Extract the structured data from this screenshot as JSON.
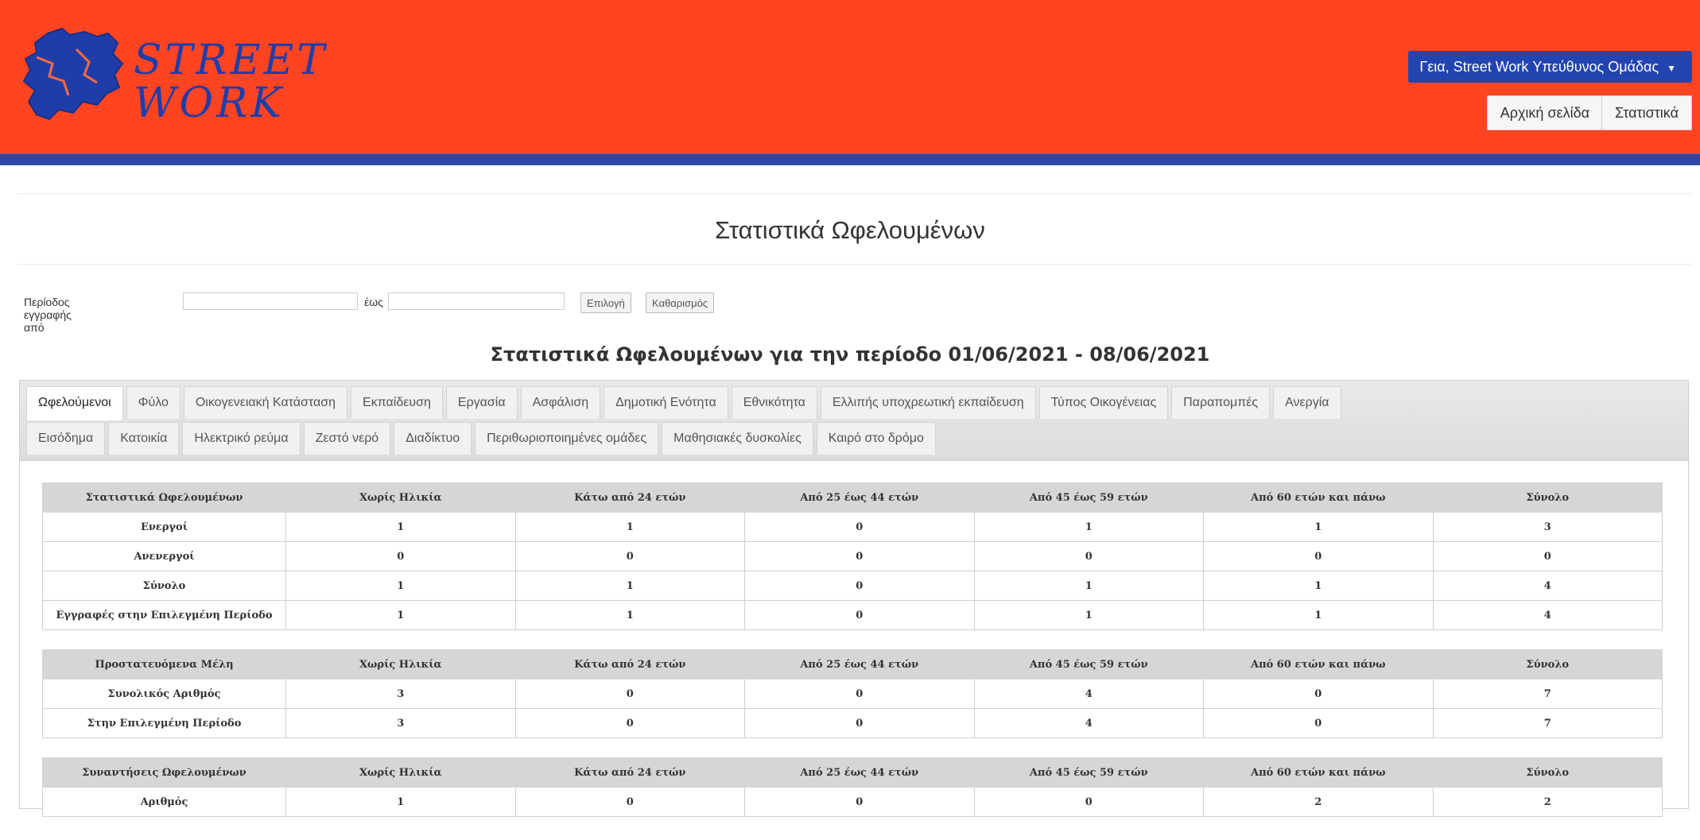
{
  "brand": {
    "line1": "STREET",
    "line2": "WORK",
    "colors": {
      "header": "#ff4422",
      "strip": "#2a46a6",
      "logo": "#1f3da8"
    }
  },
  "header": {
    "user_menu": "Γεια, Street Work Υπεύθυνος Ομάδας",
    "caret_icon": "caret-down-icon",
    "nav": {
      "home": "Αρχική σελίδα",
      "stats": "Στατιστικά"
    }
  },
  "page_title": "Στατιστικά Ωφελουμένων",
  "filter": {
    "from_label": "Περίοδος εγγραφής από",
    "from_value": "",
    "to_label": "έως",
    "to_value": "",
    "select_button": "Επιλογή",
    "clear_button": "Καθαρισμός"
  },
  "period_title": "Στατιστικά Ωφελουμένων για την περίοδο 01/06/2021 - 08/06/2021",
  "tabs": {
    "row1": [
      "Ωφελούμενοι",
      "Φύλο",
      "Οικογενειακή Κατάσταση",
      "Εκπαίδευση",
      "Εργασία",
      "Ασφάλιση",
      "Δημοτική Ενότητα",
      "Εθνικότητα",
      "Ελλιπής υποχρεωτική εκπαίδευση",
      "Τύπος Οικογένειας",
      "Παραπομπές",
      "Ανεργία"
    ],
    "row2": [
      "Εισόδημα",
      "Κατοικία",
      "Ηλεκτρικό ρεύμα",
      "Ζεστό νερό",
      "Διαδίκτυο",
      "Περιθωριοποιημένες ομάδες",
      "Μαθησιακές δυσκολίες",
      "Καιρό στο δρόμο"
    ],
    "active": "Ωφελούμενοι"
  },
  "tables": [
    {
      "headers": [
        "Στατιστικά Ωφελουμένων",
        "Χωρίς Ηλικία",
        "Κάτω από 24 ετών",
        "Από 25 έως 44 ετών",
        "Από 45 έως 59 ετών",
        "Από 60 ετών και πάνω",
        "Σύνολο"
      ],
      "rows": [
        [
          "Ενεργοί",
          "1",
          "1",
          "0",
          "1",
          "1",
          "3"
        ],
        [
          "Ανενεργοί",
          "0",
          "0",
          "0",
          "0",
          "0",
          "0"
        ],
        [
          "Σύνολο",
          "1",
          "1",
          "0",
          "1",
          "1",
          "4"
        ],
        [
          "Εγγραφές στην Επιλεγμένη Περίοδο",
          "1",
          "1",
          "0",
          "1",
          "1",
          "4"
        ]
      ]
    },
    {
      "headers": [
        "Προστατευόμενα Μέλη",
        "Χωρίς Ηλικία",
        "Κάτω από 24 ετών",
        "Από 25 έως 44 ετών",
        "Από 45 έως 59 ετών",
        "Από 60 ετών και πάνω",
        "Σύνολο"
      ],
      "rows": [
        [
          "Συνολικός Αριθμός",
          "3",
          "0",
          "0",
          "4",
          "0",
          "7"
        ],
        [
          "Στην Επιλεγμένη Περίοδο",
          "3",
          "0",
          "0",
          "4",
          "0",
          "7"
        ]
      ]
    },
    {
      "headers": [
        "Συναντήσεις Ωφελουμένων",
        "Χωρίς Ηλικία",
        "Κάτω από 24 ετών",
        "Από 25 έως 44 ετών",
        "Από 45 έως 59 ετών",
        "Από 60 ετών και πάνω",
        "Σύνολο"
      ],
      "rows": [
        [
          "Αριθμός",
          "1",
          "0",
          "0",
          "0",
          "2",
          "2"
        ]
      ]
    }
  ]
}
